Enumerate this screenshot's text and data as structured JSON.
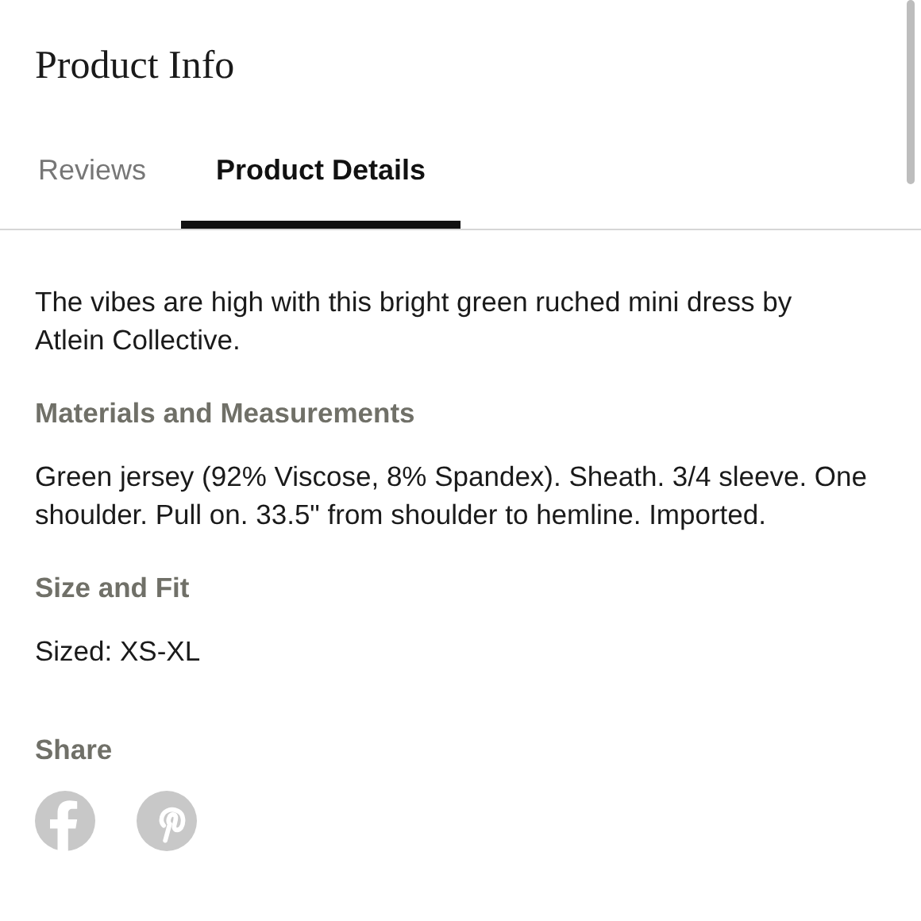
{
  "title": "Product Info",
  "tabs": [
    {
      "label": "Reviews",
      "selected": false
    },
    {
      "label": "Product Details",
      "selected": true
    }
  ],
  "description": "The vibes are high with this bright green ruched mini dress by Atlein Collective.",
  "sections": [
    {
      "heading": "Materials and Measurements",
      "text": "Green jersey (92% Viscose, 8% Spandex). Sheath. 3/4 sleeve. One shoulder. Pull on. 33.5\" from shoulder to hemline. Imported."
    },
    {
      "heading": "Size and Fit",
      "text": "Sized: XS-XL"
    }
  ],
  "share": {
    "heading": "Share",
    "buttons": [
      {
        "kind": "facebook"
      },
      {
        "kind": "pinterest"
      }
    ]
  }
}
